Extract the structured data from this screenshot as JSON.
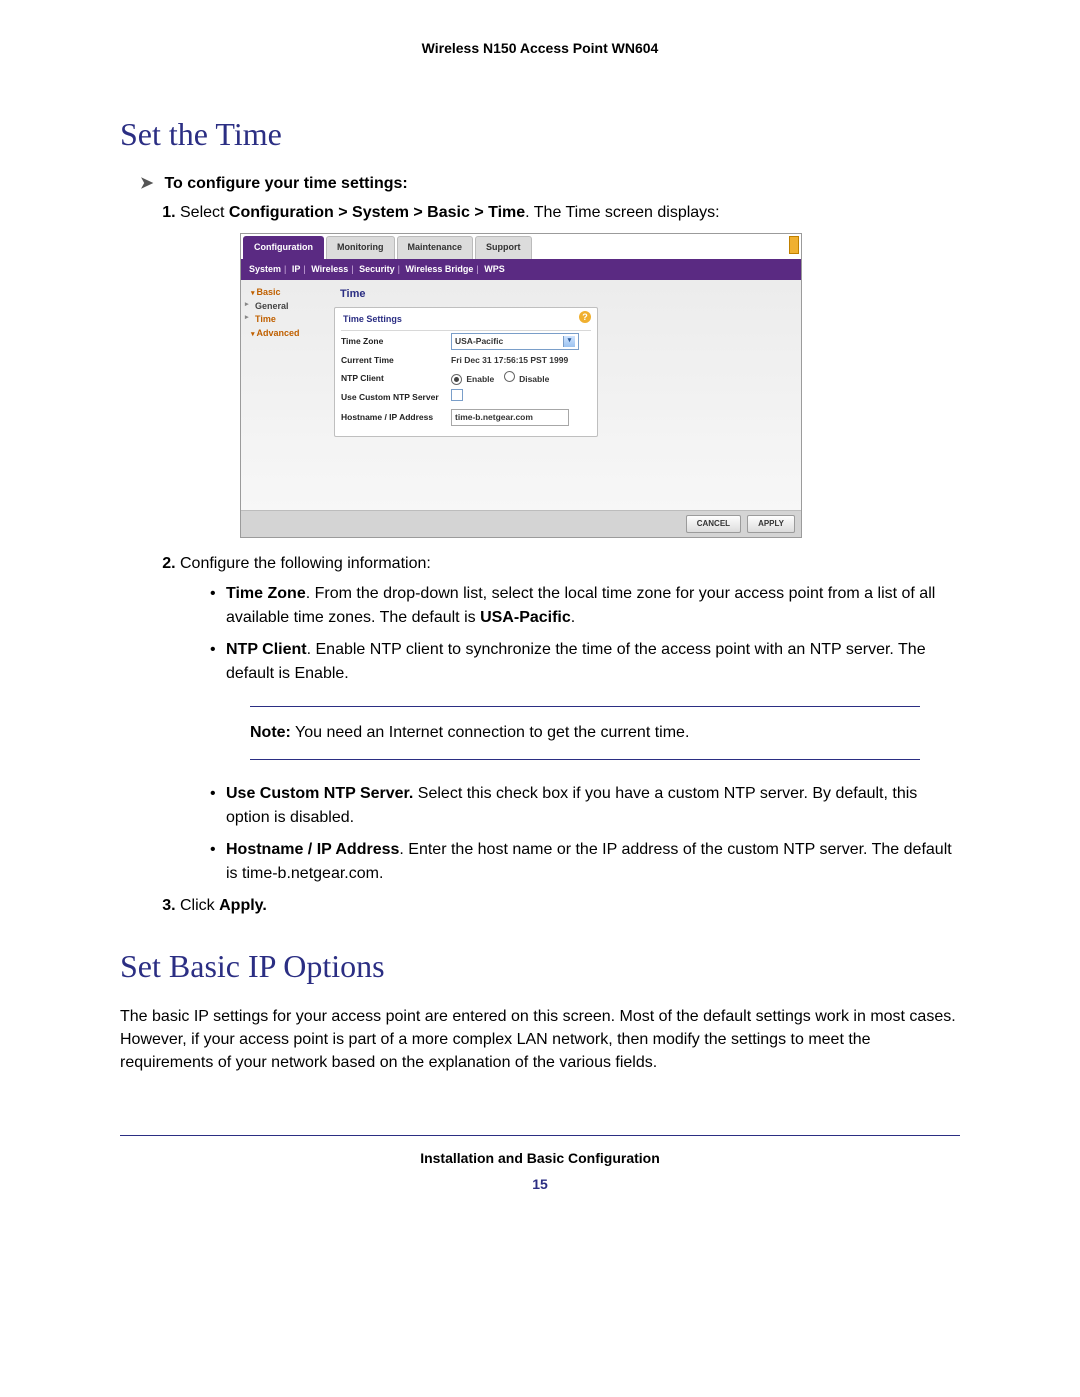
{
  "header": {
    "product": "Wireless N150 Access Point WN604"
  },
  "h1_time": "Set the Time",
  "task_lead": "To configure your time settings:",
  "step1_prefix": "Select ",
  "step1_path": "Configuration > System > Basic > Time",
  "step1_suffix": ". The Time screen displays:",
  "step2": "Configure the following information:",
  "bullet_tz_lead": "Time Zone",
  "bullet_tz_body": ". From the drop-down list, select the local time zone for your access point from a list of all available time zones. The default is ",
  "bullet_tz_default": "USA-Pacific",
  "bullet_ntp_lead": "NTP Client",
  "bullet_ntp_body": ". Enable NTP client to synchronize the time of the access point with an NTP server. The default is Enable.",
  "note_label": "Note:",
  "note_text": "  You need an Internet connection to get the current time.",
  "bullet_custom_lead": "Use Custom NTP Server.",
  "bullet_custom_body": " Select this check box if you have a custom NTP server. By default, this option is disabled.",
  "bullet_host_lead": "Hostname / IP Address",
  "bullet_host_body": ". Enter the host name or the IP address of the custom NTP server. The default is time-b.netgear.com.",
  "step3_prefix": "Click ",
  "step3_action": "Apply.",
  "h1_ip": "Set Basic IP Options",
  "ip_para": "The basic IP settings for your access point are entered on this screen. Most of the default settings work in most cases. However, if your access point is part of a more complex LAN network, then modify the settings to meet the requirements of your network based on the explanation of the various fields.",
  "footer": {
    "chapter": "Installation and Basic Configuration",
    "page": "15"
  },
  "app": {
    "tabs": {
      "t0": "Configuration",
      "t1": "Monitoring",
      "t2": "Maintenance",
      "t3": "Support"
    },
    "subnav": {
      "s0": "System",
      "s1": "IP",
      "s2": "Wireless",
      "s3": "Security",
      "s4": "Wireless Bridge",
      "s5": "WPS"
    },
    "side": {
      "basic": "Basic",
      "general": "General",
      "time": "Time",
      "advanced": "Advanced"
    },
    "panel": {
      "title": "Time",
      "subtitle": "Time Settings",
      "rows": {
        "tz_label": "Time Zone",
        "tz_value": "USA-Pacific",
        "ct_label": "Current Time",
        "ct_value": "Fri Dec 31 17:56:15 PST 1999",
        "ntp_label": "NTP Client",
        "ntp_enable": "Enable",
        "ntp_disable": "Disable",
        "custom_label": "Use Custom NTP Server",
        "host_label": "Hostname / IP Address",
        "host_value": "time-b.netgear.com"
      }
    },
    "buttons": {
      "cancel": "CANCEL",
      "apply": "APPLY"
    }
  }
}
